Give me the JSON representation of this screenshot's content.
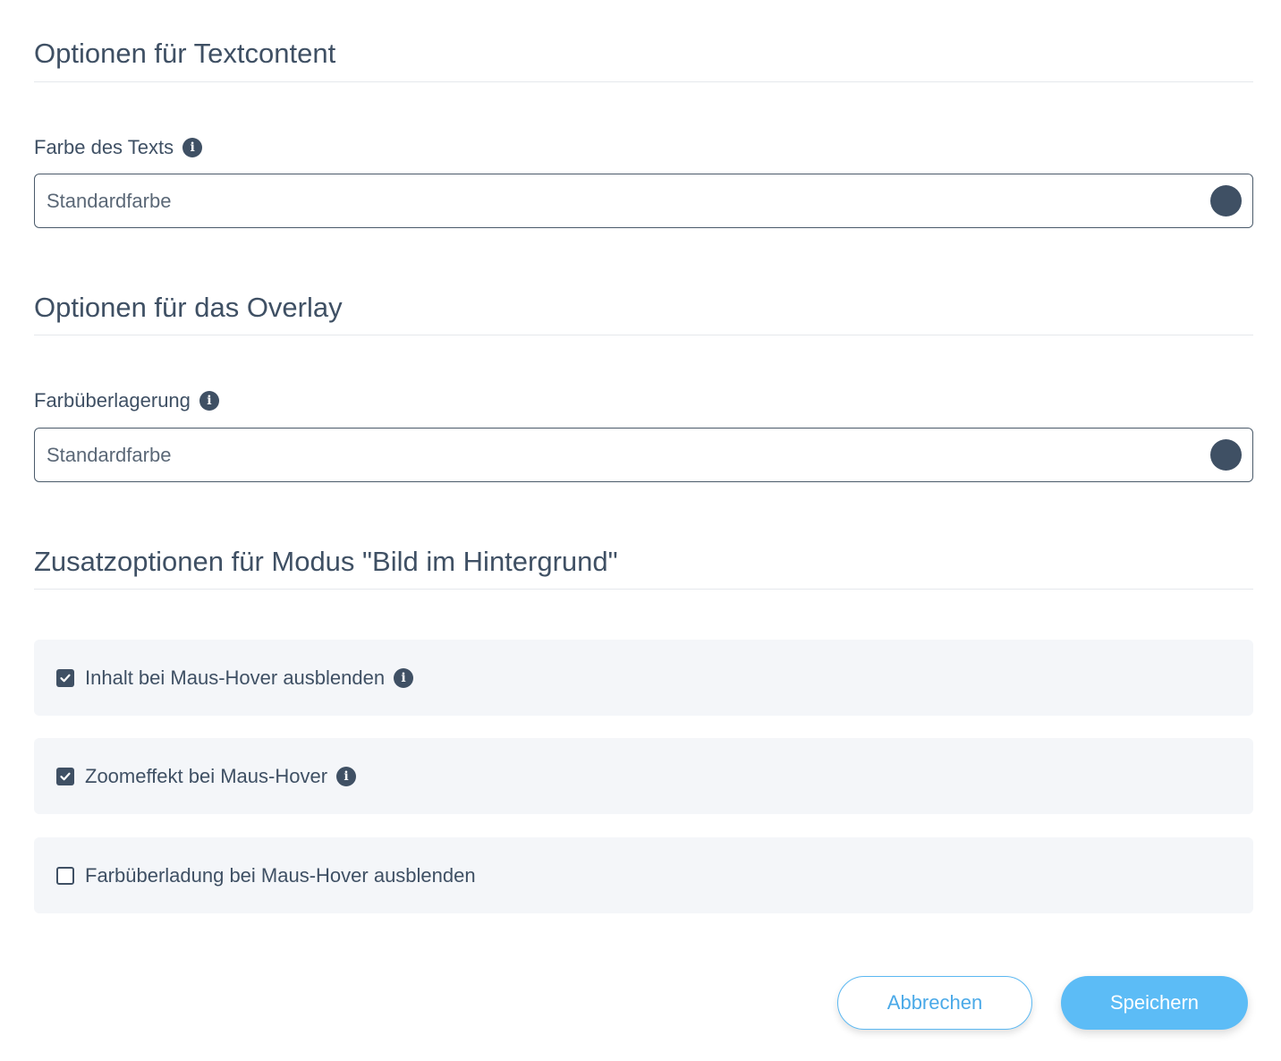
{
  "sections": {
    "text_content": {
      "title": "Optionen für Textcontent",
      "field_label": "Farbe des Texts",
      "field_value": "Standardfarbe",
      "swatch_color": "#3f5064"
    },
    "overlay": {
      "title": "Optionen für das Overlay",
      "field_label": "Farbüberlagerung",
      "field_value": "Standardfarbe",
      "swatch_color": "#3f5064"
    },
    "background_mode": {
      "title": "Zusatzoptionen für Modus \"Bild im Hintergrund\"",
      "options": [
        {
          "label": "Inhalt bei Maus-Hover ausblenden",
          "checked": true,
          "has_info": true
        },
        {
          "label": "Zoomeffekt bei Maus-Hover",
          "checked": true,
          "has_info": true
        },
        {
          "label": "Farbüberladung bei Maus-Hover ausblenden",
          "checked": false,
          "has_info": false
        }
      ]
    }
  },
  "buttons": {
    "cancel_label": "Abbrechen",
    "save_label": "Speichern"
  },
  "colors": {
    "text": "#3f5064",
    "accent": "#5cbcf6",
    "option_background": "#f4f6f9"
  },
  "icons": {
    "info": "info-circle-icon",
    "check": "checkmark-icon"
  }
}
